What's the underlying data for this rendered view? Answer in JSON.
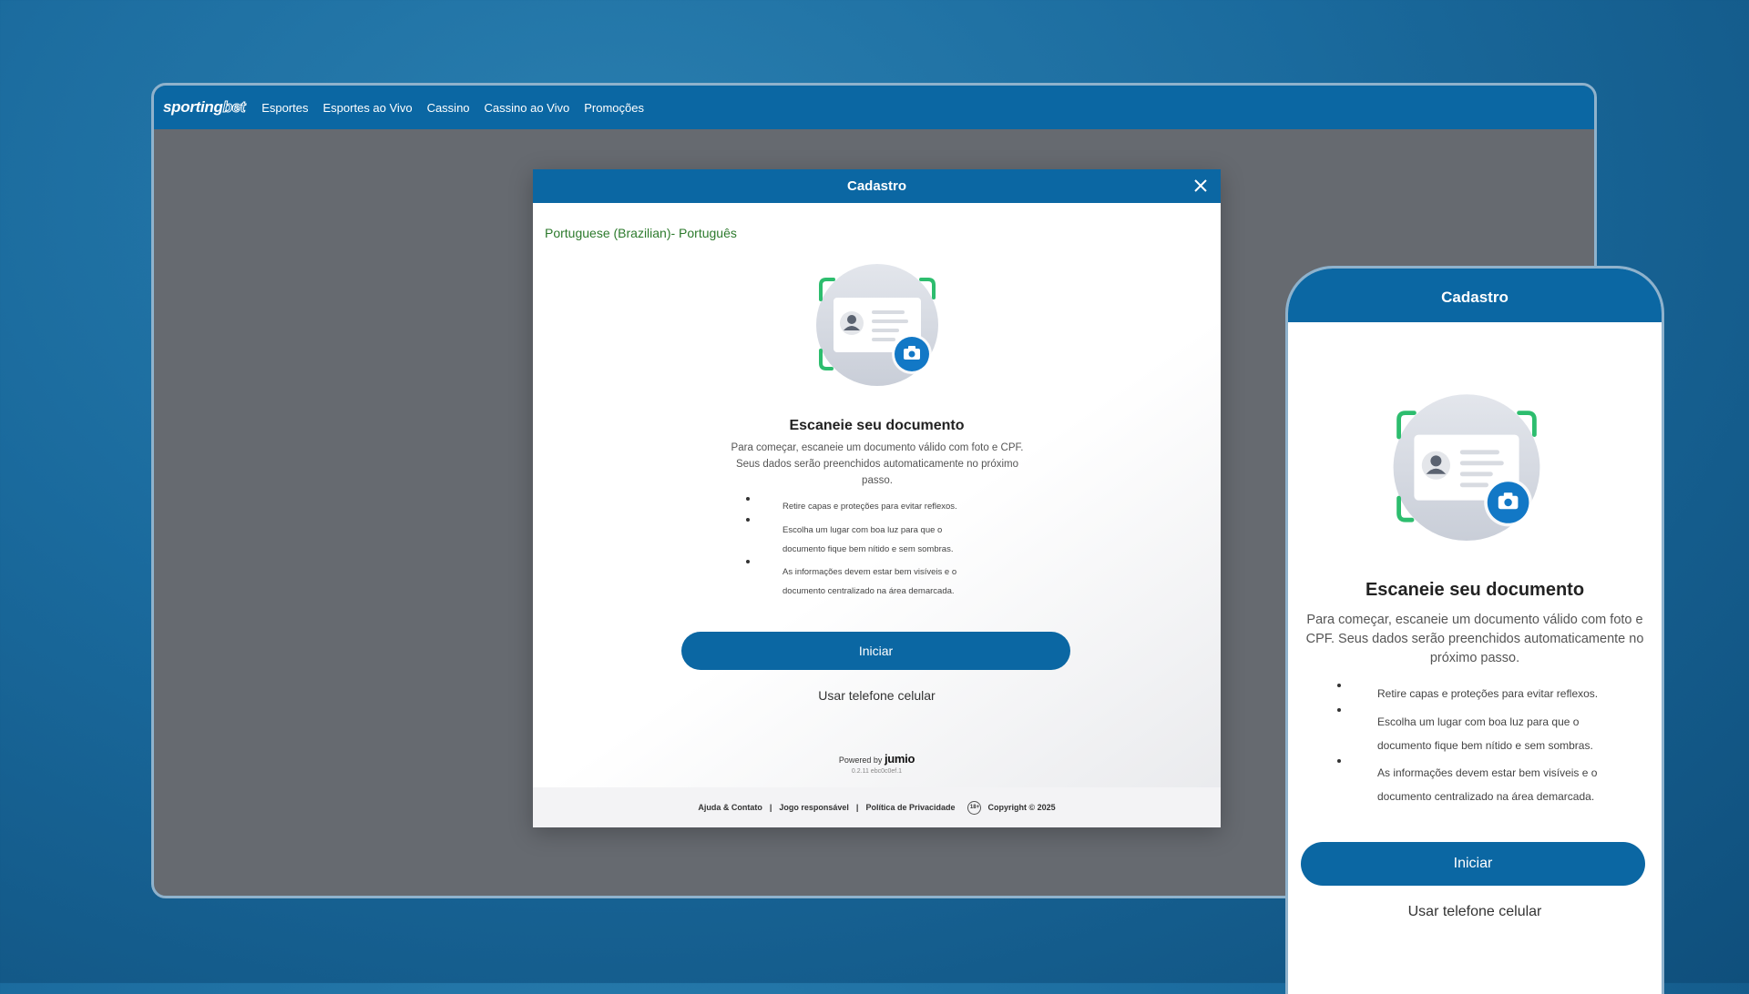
{
  "navbar": {
    "logo_main": "sporting",
    "logo_accent": "bet",
    "items": [
      {
        "label": "Esportes"
      },
      {
        "label": "Esportes ao Vivo"
      },
      {
        "label": "Cassino"
      },
      {
        "label": "Cassino ao Vivo"
      },
      {
        "label": "Promoções"
      }
    ]
  },
  "modal": {
    "title": "Cadastro",
    "language": "Portuguese (Brazilian)- Português",
    "heading": "Escaneie seu documento",
    "description": "Para começar, escaneie um documento válido com foto e CPF. Seus dados serão preenchidos automaticamente no próximo passo.",
    "tips": [
      "Retire capas e proteções para evitar reflexos.",
      "Escolha um lugar com boa luz para que o documento fique bem nítido e sem sombras.",
      "As informações devem estar bem visíveis e o documento centralizado na área demarcada."
    ],
    "start_button": "Iniciar",
    "use_phone": "Usar telefone celular",
    "powered_by": "Powered by",
    "powered_brand": "jumio",
    "version": "0.2.11 ebc0c0ef.1"
  },
  "footer": {
    "help": "Ajuda & Contato",
    "responsible": "Jogo responsável",
    "privacy": "Política de Privacidade",
    "age_badge": "18+",
    "copyright": "Copyright © 2025"
  },
  "phone": {
    "title": "Cadastro",
    "heading": "Escaneie seu documento",
    "description": "Para começar, escaneie um documento válido com foto e CPF. Seus dados serão preenchidos automaticamente no próximo passo.",
    "tips": [
      "Retire capas e proteções para evitar reflexos.",
      "Escolha um lugar com boa luz para que o documento fique bem nítido e sem sombras.",
      "As informações devem estar bem visíveis e o documento centralizado na área demarcada."
    ],
    "start_button": "Iniciar",
    "use_phone": "Usar telefone celular"
  },
  "colors": {
    "brand_blue": "#0b67a3",
    "accent_green": "#2dbd6e",
    "language_green": "#2c7a2c"
  }
}
